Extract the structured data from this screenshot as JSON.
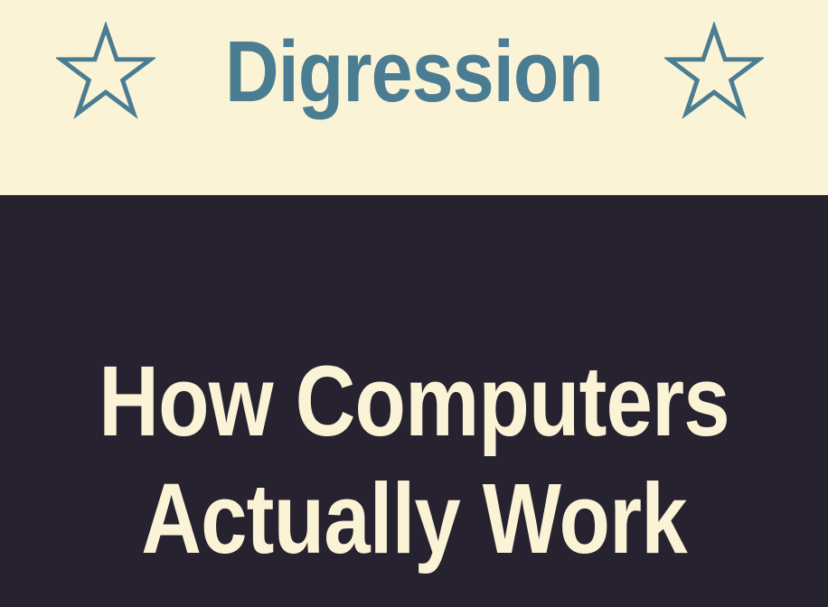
{
  "slide": {
    "section_title": "Digression",
    "title_line_1": "How Computers",
    "title_line_2": "Actually Work",
    "left_icon": "star-outline-icon",
    "right_icon": "star-outline-icon"
  },
  "colors": {
    "header_background": "#fbf3d6",
    "body_background": "#26222f",
    "accent": "#4a7d92",
    "title_text": "#fbf3d6"
  }
}
